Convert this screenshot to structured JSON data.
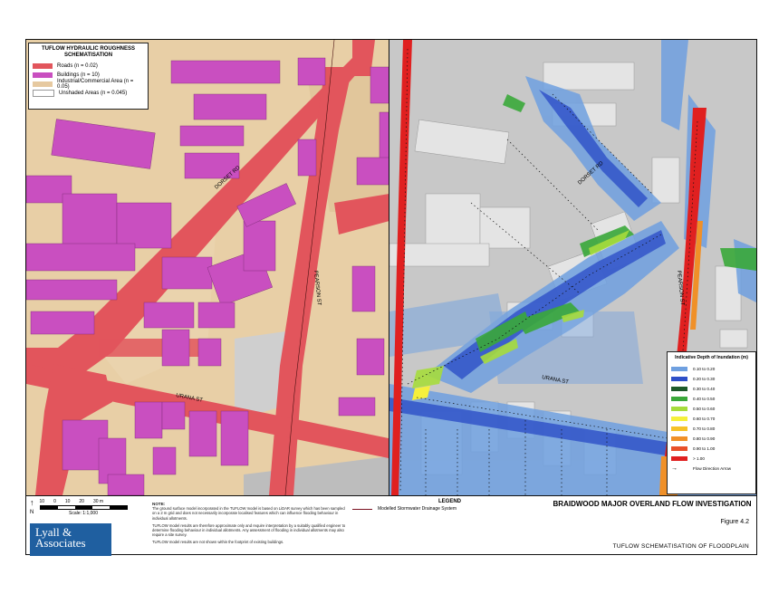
{
  "left_legend": {
    "title": "TUFLOW HYDRAULIC ROUGHNESS SCHEMATISATION",
    "items": [
      {
        "label": "Roads (n = 0.02)",
        "color": "#e2555c"
      },
      {
        "label": "Buildings (n = 10)",
        "color": "#c94fc0"
      },
      {
        "label": "Industrial/Commercial Area (n = 0.05)",
        "color": "#e6c9a0"
      },
      {
        "label": "Unshaded Areas (n = 0.045)",
        "color": "#ffffff"
      }
    ]
  },
  "streets": {
    "dorset": "DORSET RD",
    "pearson_left": "PEARSON ST",
    "urana_left": "URANA ST",
    "dorset_right": "DORSET RD",
    "pearson_right": "PEARSON ST",
    "urana_right": "URANA ST"
  },
  "depth_legend": {
    "title": "Indicative Depth of Inundation (m)",
    "items": [
      {
        "label": "0.10 to 0.20",
        "color": "#6fa0e0"
      },
      {
        "label": "0.20 to 0.30",
        "color": "#2d4fc8"
      },
      {
        "label": "0.30 to 0.40",
        "color": "#1d5a2a"
      },
      {
        "label": "0.40 to 0.50",
        "color": "#3aa83a"
      },
      {
        "label": "0.50 to 0.60",
        "color": "#a6dc3c"
      },
      {
        "label": "0.60 to 0.70",
        "color": "#f5f03c"
      },
      {
        "label": "0.70 to 0.80",
        "color": "#f5c228"
      },
      {
        "label": "0.80 to 0.90",
        "color": "#f09028"
      },
      {
        "label": "0.90 to 1.00",
        "color": "#e8502a"
      },
      {
        "label": "> 1.00",
        "color": "#e02020"
      }
    ],
    "arrow_label": "Flow Direction Arrow"
  },
  "scale": {
    "north": "N",
    "ticks": [
      "10",
      "0",
      "10",
      "20",
      "30 m"
    ],
    "label": "Scale: 1:1,000"
  },
  "notes": {
    "heading": "NOTE:",
    "p1": "The ground surface model incorporated in the TUFLOW model is based on LiDAR survey which has been sampled on a 2 m grid and does not necessarily incorporate localised features which can influence flooding behaviour in individual allotments.",
    "p2": "TUFLOW model results are therefore approximate only and require interpretation by a suitably qualified engineer to determine flooding behaviour in individual allotments. Any assessment of flooding in individual allotments may also require a site survey.",
    "p3": "TUFLOW model results are not shown within the footprint of existing buildings."
  },
  "legend_bottom": {
    "heading": "LEGEND",
    "item": "Modelled Stormwater Drainage System"
  },
  "logo": {
    "line1": "Lyall &",
    "line2": "Associates"
  },
  "title_block": {
    "project": "BRAIDWOOD MAJOR OVERLAND FLOW INVESTIGATION",
    "figure": "Figure 4.2",
    "subtitle": "TUFLOW SCHEMATISATION OF FLOODPLAIN"
  }
}
